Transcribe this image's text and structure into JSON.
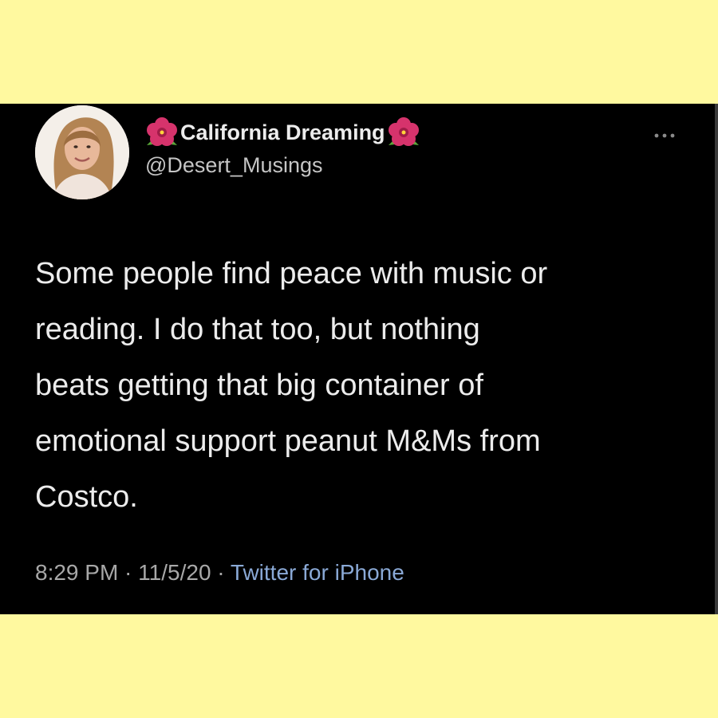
{
  "user": {
    "display_name": "California Dreaming",
    "handle": "@Desert_Musings",
    "name_emoji": "hibiscus-icon",
    "avatar_icon": "avatar-photo"
  },
  "more_icon": "more-options-icon",
  "tweet": {
    "text": "Some people find peace with music or\nreading. I do that too, but nothing\nbeats getting that big container of\nemotional support peanut M&Ms from\nCostco."
  },
  "meta": {
    "time": "8:29 PM",
    "separator": " · ",
    "date": "11/5/20",
    "source": "Twitter for iPhone"
  },
  "colors": {
    "page_background": "#fff99f",
    "card_background": "#000000",
    "text_primary": "#ececec",
    "text_secondary": "#a8a8a8",
    "link": "#8aa9d6"
  }
}
